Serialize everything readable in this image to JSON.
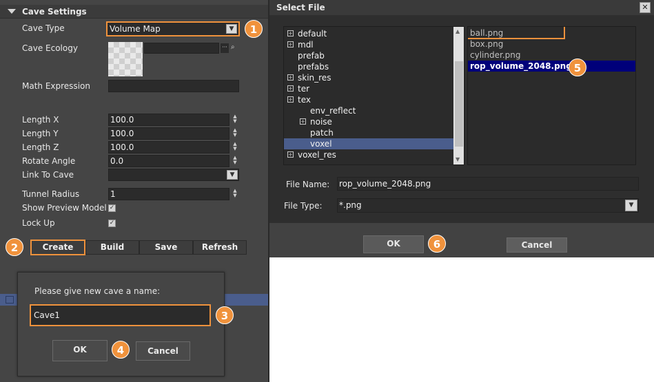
{
  "settings": {
    "section_title": "Cave Settings",
    "cave_type_label": "Cave Type",
    "cave_type_value": "Volume Map",
    "cave_ecology_label": "Cave Ecology",
    "math_expression_label": "Math Expression",
    "length_x_label": "Length X",
    "length_x_value": "100.0",
    "length_y_label": "Length Y",
    "length_y_value": "100.0",
    "length_z_label": "Length Z",
    "length_z_value": "100.0",
    "rotate_angle_label": "Rotate Angle",
    "rotate_angle_value": "0.0",
    "link_to_cave_label": "Link To Cave",
    "tunnel_radius_label": "Tunnel Radius",
    "tunnel_radius_value": "1",
    "show_preview_label": "Show Preview Model",
    "show_preview_checked": true,
    "lock_up_label": "Lock Up",
    "lock_up_checked": true,
    "ellipsis": "···"
  },
  "toolbar": {
    "create": "Create",
    "build": "Build",
    "save": "Save",
    "refresh": "Refresh"
  },
  "name_dialog": {
    "prompt": "Please give new cave a name:",
    "value": "Cave1",
    "ok": "OK",
    "cancel": "Cancel"
  },
  "file_dialog": {
    "title": "Select File",
    "close": "✕",
    "tree": [
      {
        "label": "default",
        "expandable": true,
        "depth": 0
      },
      {
        "label": "mdl",
        "expandable": true,
        "depth": 0
      },
      {
        "label": "prefab",
        "expandable": false,
        "depth": 0
      },
      {
        "label": "prefabs",
        "expandable": false,
        "depth": 0
      },
      {
        "label": "skin_res",
        "expandable": true,
        "depth": 0
      },
      {
        "label": "ter",
        "expandable": true,
        "depth": 0
      },
      {
        "label": "tex",
        "expandable": true,
        "depth": 0
      },
      {
        "label": "env_reflect",
        "expandable": false,
        "depth": 1
      },
      {
        "label": "noise",
        "expandable": true,
        "depth": 1
      },
      {
        "label": "patch",
        "expandable": false,
        "depth": 1
      },
      {
        "label": "voxel",
        "expandable": false,
        "depth": 1,
        "selected": true
      },
      {
        "label": "voxel_res",
        "expandable": true,
        "depth": 0
      }
    ],
    "files": [
      {
        "label": "ball.png"
      },
      {
        "label": "box.png"
      },
      {
        "label": "cylinder.png"
      },
      {
        "label": "rop_volume_2048.png",
        "selected": true
      }
    ],
    "file_name_label": "File Name:",
    "file_name_value": "rop_volume_2048.png",
    "file_type_label": "File Type:",
    "file_type_value": "*.png",
    "ok": "OK",
    "cancel": "Cancel"
  },
  "badges": [
    "1",
    "2",
    "3",
    "4",
    "5",
    "6"
  ],
  "colors": {
    "highlight": "#f0923c",
    "selection": "#00007a",
    "tree_selection": "#4a5d8c"
  }
}
